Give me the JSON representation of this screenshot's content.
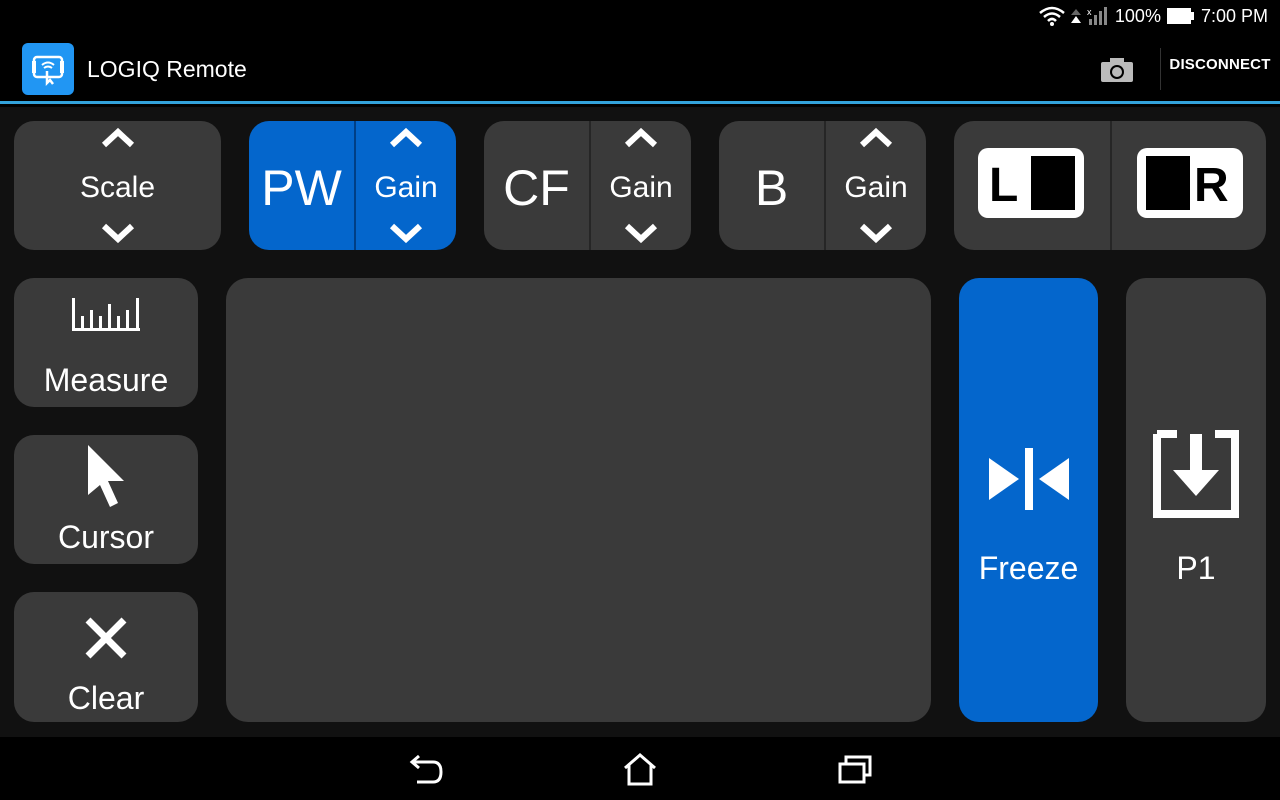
{
  "status": {
    "battery": "100%",
    "time": "7:00 PM"
  },
  "app": {
    "title": "LOGIQ Remote",
    "disconnect_label": "DISCONNECT"
  },
  "top_controls": {
    "scale": {
      "label": "Scale"
    },
    "pw": {
      "mode_label": "PW",
      "gain_label": "Gain",
      "active": true
    },
    "cf": {
      "mode_label": "CF",
      "gain_label": "Gain",
      "active": false
    },
    "b": {
      "mode_label": "B",
      "gain_label": "Gain",
      "active": false
    },
    "lr": {
      "left_letter": "L",
      "right_letter": "R"
    }
  },
  "side_buttons": {
    "measure": "Measure",
    "cursor": "Cursor",
    "clear": "Clear"
  },
  "freeze": {
    "label": "Freeze"
  },
  "p1": {
    "label": "P1"
  },
  "colors": {
    "accent_blue": "#0466cc",
    "panel_gray": "#3a3a3a",
    "appbar_line": "#33a3dc"
  },
  "icons": {
    "camera": "camera-icon",
    "measure": "ruler-icon",
    "cursor": "cursor-arrow-icon",
    "clear": "close-x-icon",
    "freeze": "freeze-icon",
    "p1": "save-download-icon",
    "nav_back": "back-icon",
    "nav_home": "home-icon",
    "nav_recents": "recents-icon"
  }
}
